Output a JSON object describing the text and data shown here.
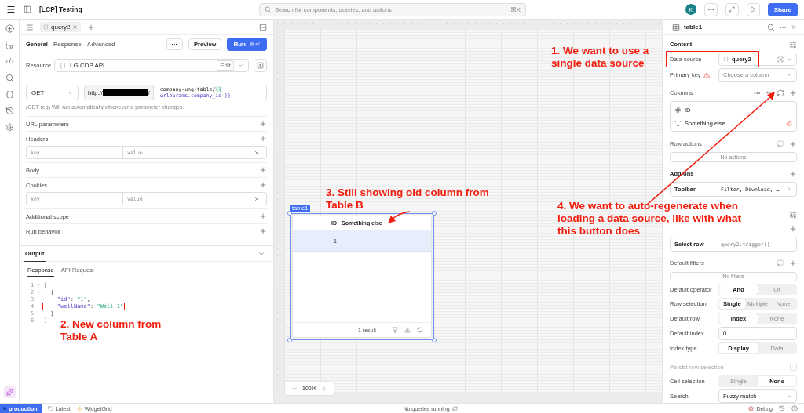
{
  "top_bar": {
    "title": "[LCP] Testing",
    "search_placeholder": "Search for components, queries, and actions",
    "search_shortcut": "⌘K",
    "avatar": "K",
    "share": "Share"
  },
  "query_tabs": [
    {
      "label": "query2",
      "selected": true
    }
  ],
  "editor_tabs": [
    {
      "label": "General",
      "selected": true
    },
    {
      "label": "Response",
      "selected": false
    },
    {
      "label": "Advanced",
      "selected": false
    }
  ],
  "actions": {
    "more": "···",
    "preview": "Preview",
    "run": "Run",
    "run_shortcut": "⌘↵"
  },
  "resource": {
    "label": "Resource",
    "value": "LG CDP API",
    "edit": "Edit"
  },
  "request": {
    "method": "GET",
    "url_prefix": "http://",
    "url_suffix": "/",
    "path": "company-unq-table/",
    "template_open": "{{",
    "template_body": "urlparams.company_id }}"
  },
  "hint": "(GET req) Will run automatically whenever a parameter changes.",
  "sections": [
    {
      "kind": "section",
      "label": "URL parameters"
    },
    {
      "kind": "section",
      "label": "Headers"
    },
    {
      "kind": "pair",
      "key_placeholder": "key",
      "value_placeholder": "value"
    },
    {
      "kind": "section",
      "label": "Body"
    },
    {
      "kind": "section",
      "label": "Cookies"
    },
    {
      "kind": "pair",
      "key_placeholder": "key",
      "value_placeholder": "value"
    },
    {
      "kind": "section",
      "label": "Additional scope"
    },
    {
      "kind": "section",
      "label": "Run behavior"
    }
  ],
  "output": {
    "title": "Output",
    "tabs": [
      {
        "label": "Response",
        "selected": true
      },
      {
        "label": "API Request",
        "selected": false
      }
    ],
    "lines": [
      {
        "num": "1",
        "fold": true,
        "highlighted": false,
        "parts": [
          {
            "kind": "punct",
            "text": "["
          }
        ]
      },
      {
        "num": "2",
        "fold": true,
        "highlighted": false,
        "parts": [
          {
            "kind": "punct",
            "text": "  {"
          }
        ]
      },
      {
        "num": "3",
        "fold": false,
        "highlighted": false,
        "parts": [
          {
            "kind": "key",
            "text": "    \"id\""
          },
          {
            "kind": "punct",
            "text": ": "
          },
          {
            "kind": "string",
            "text": "\"1\""
          },
          {
            "kind": "punct",
            "text": ","
          }
        ]
      },
      {
        "num": "4",
        "fold": false,
        "highlighted": true,
        "parts": [
          {
            "kind": "key",
            "text": "    \"wellName\""
          },
          {
            "kind": "punct",
            "text": ": "
          },
          {
            "kind": "string",
            "text": "\"Well 1\""
          }
        ]
      },
      {
        "num": "5",
        "fold": false,
        "highlighted": false,
        "parts": [
          {
            "kind": "punct",
            "text": "  }"
          }
        ]
      },
      {
        "num": "6",
        "fold": false,
        "highlighted": false,
        "parts": [
          {
            "kind": "punct",
            "text": "]"
          }
        ]
      }
    ]
  },
  "canvas": {
    "component": "table1",
    "table": {
      "columns": [
        "ID",
        "Something else"
      ],
      "rows": [
        [
          "1",
          ""
        ]
      ],
      "footer": "1 result"
    },
    "zoom": "100%"
  },
  "inspector": {
    "title": "table1",
    "content": "Content",
    "data_source": {
      "label": "Data source",
      "value": "query2",
      "highlighted": true
    },
    "primary_key": {
      "label": "Primary key",
      "placeholder": "Choose a column",
      "warning": true
    },
    "columns_label": "Columns",
    "columns": [
      {
        "kind": "number",
        "name": "ID",
        "warning": false
      },
      {
        "kind": "text",
        "name": "Something else",
        "warning": true
      }
    ],
    "row_actions": {
      "label": "Row actions",
      "empty": "No actions"
    },
    "addons": {
      "label": "Add-ons",
      "name": "Toolbar",
      "value": "Filter, Download, …"
    },
    "event": {
      "name": "Select row",
      "value": "query2.trigger()"
    },
    "default_filters": {
      "label": "Default filters",
      "empty": "No filters"
    },
    "settings": [
      {
        "kind": "segmented",
        "label": "Default operator",
        "disabled": false,
        "options": [
          {
            "label": "And",
            "selected": true
          },
          {
            "label": "Or",
            "selected": false
          }
        ]
      },
      {
        "kind": "segmented",
        "label": "Row selection",
        "disabled": false,
        "options": [
          {
            "label": "Single",
            "selected": true
          },
          {
            "label": "Multiple",
            "selected": false
          },
          {
            "label": "None",
            "selected": false
          }
        ]
      },
      {
        "kind": "segmented",
        "label": "Default row",
        "disabled": false,
        "options": [
          {
            "label": "Index",
            "selected": true
          },
          {
            "label": "None",
            "selected": false
          }
        ]
      },
      {
        "kind": "input",
        "label": "Default index",
        "value": "0",
        "disabled": false
      },
      {
        "kind": "segmented",
        "label": "Index type",
        "disabled": false,
        "options": [
          {
            "label": "Display",
            "selected": true
          },
          {
            "label": "Data",
            "selected": false
          }
        ]
      },
      {
        "kind": "checkbox",
        "label": "Persist row selection",
        "disabled": true,
        "checked": false
      },
      {
        "kind": "segmented",
        "label": "Cell selection",
        "disabled": false,
        "options": [
          {
            "label": "Single",
            "selected": false
          },
          {
            "label": "None",
            "selected": true
          }
        ]
      },
      {
        "kind": "select",
        "label": "Search",
        "value": "Fuzzy match",
        "disabled": false
      }
    ]
  },
  "status_bar": {
    "environment": "production",
    "version": "Latest",
    "branch": "WidgetGrid",
    "queries": "No queries running",
    "debug": "Debug"
  },
  "annotations": [
    "1. We want to use a single data source",
    "2. New column from Table A",
    "3. Still showing old column from Table B",
    "4. We want to auto-regenerate when loading a data source, like with what this button does"
  ]
}
